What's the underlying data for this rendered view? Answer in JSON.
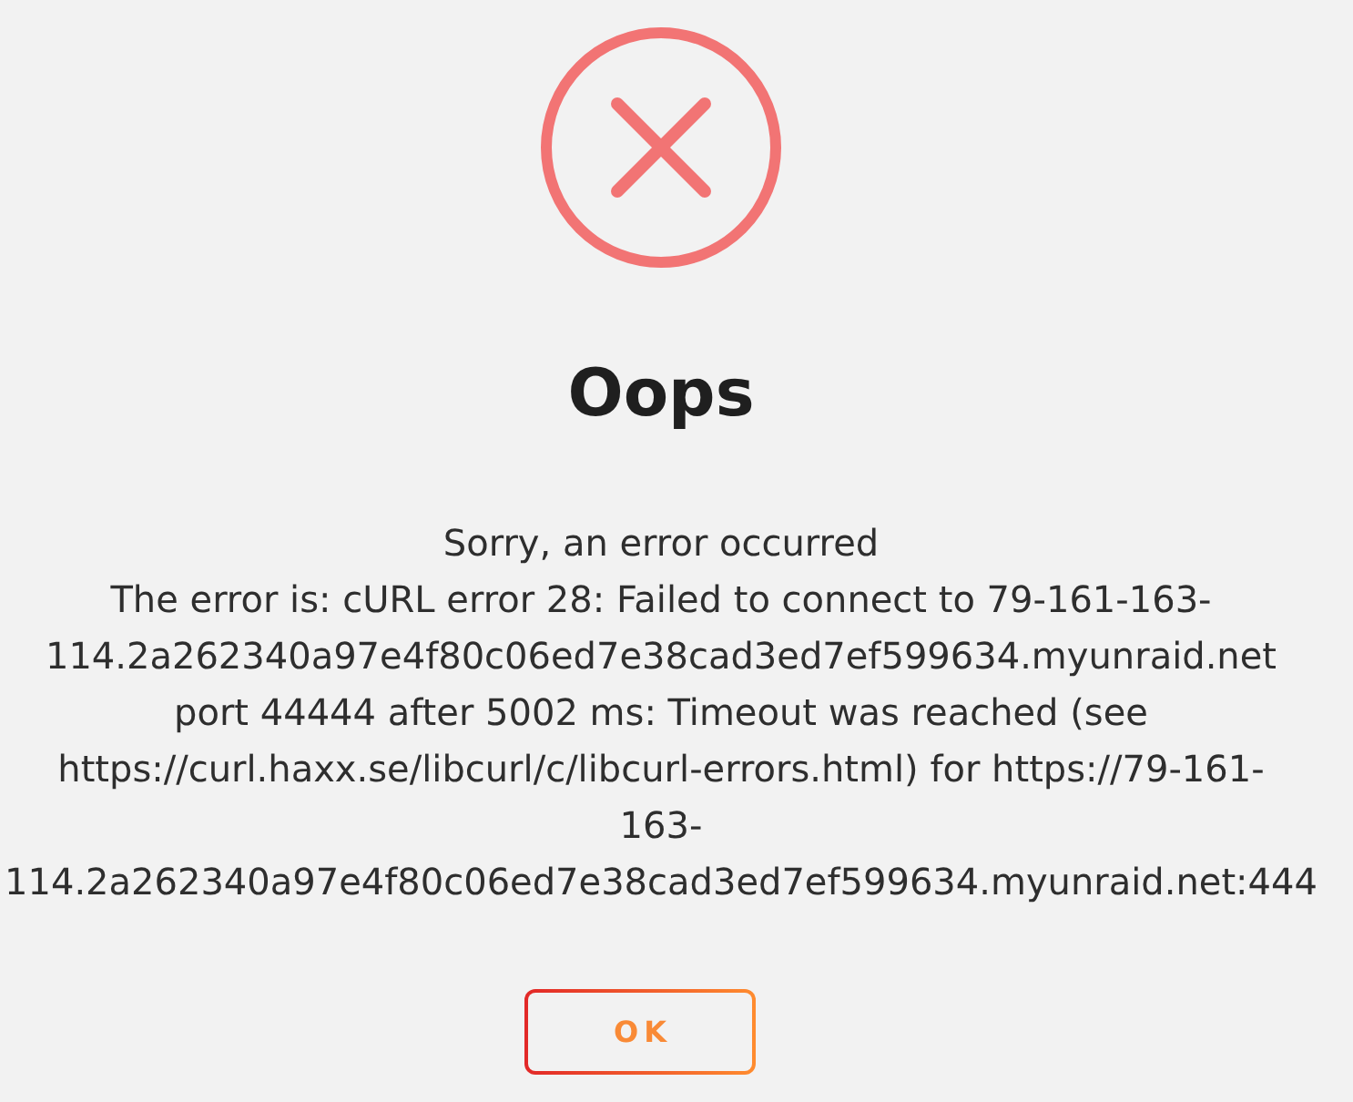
{
  "dialog": {
    "title": "Oops",
    "subtitle": "Sorry, an error occurred",
    "message": "The error is: cURL error 28: Failed to connect to 79-161-163-\n114.2a262340a97e4f80c06ed7e38cad3ed7ef599634.myunraid.net\nport 44444 after 5002 ms: Timeout was reached (see\nhttps://curl.haxx.se/libcurl/c/libcurl-errors.html) for https://79-161-\n163-\n114.2a262340a97e4f80c06ed7e38cad3ed7ef599634.myunraid.net:444",
    "buttons": [
      {
        "label": "OK",
        "kind": "confirm"
      }
    ]
  }
}
